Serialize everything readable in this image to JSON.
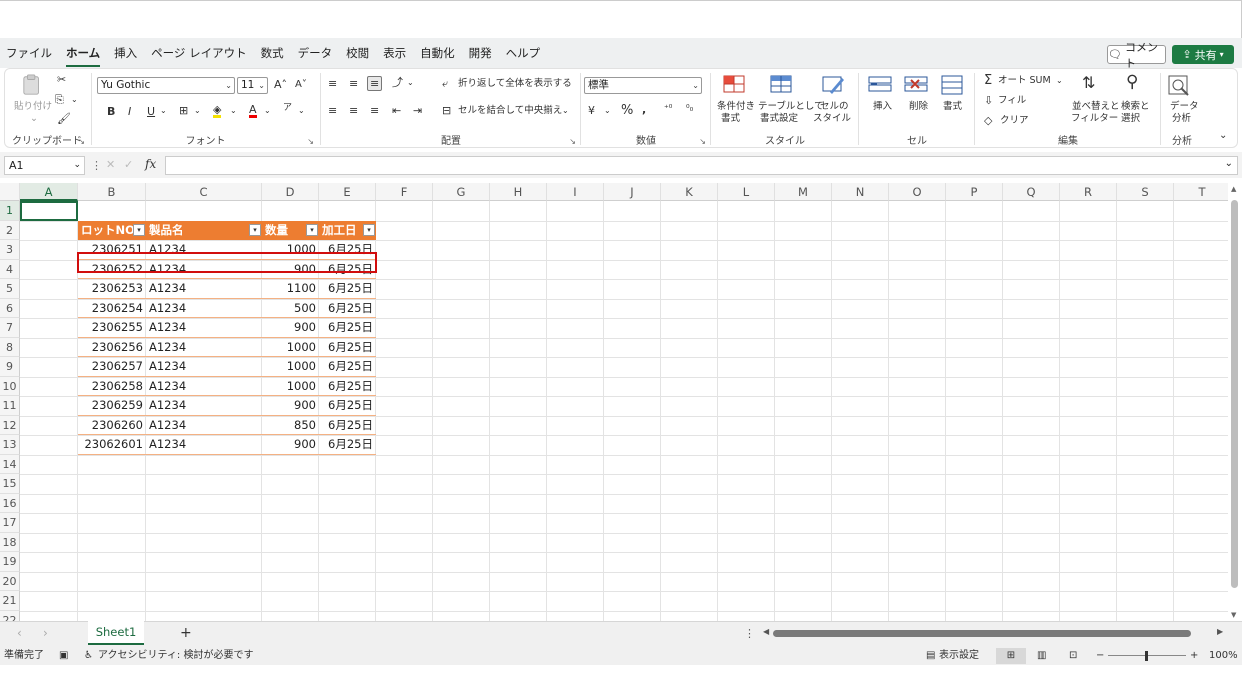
{
  "menu": {
    "tabs": [
      "ファイル",
      "ホーム",
      "挿入",
      "ページ レイアウト",
      "数式",
      "データ",
      "校閲",
      "表示",
      "自動化",
      "開発",
      "ヘルプ"
    ],
    "active_tab": "ホーム",
    "comment_label": "コメント",
    "share_label": "共有"
  },
  "ribbon": {
    "clipboard": {
      "paste": "貼り付け",
      "label": "クリップボード"
    },
    "font": {
      "family": "Yu Gothic",
      "size": "11",
      "label": "フォント"
    },
    "alignment": {
      "wrap": "折り返して全体を表示する",
      "merge": "セルを結合して中央揃え",
      "label": "配置"
    },
    "number": {
      "format": "標準",
      "label": "数値"
    },
    "styles": {
      "cond1": "条件付き",
      "cond2": "書式",
      "table1": "テーブルとして",
      "table2": "書式設定",
      "cell1": "セルの",
      "cell2": "スタイル",
      "label": "スタイル"
    },
    "cells": {
      "insert": "挿入",
      "delete": "削除",
      "format": "書式",
      "label": "セル"
    },
    "editing": {
      "autosum": "オート SUM",
      "fill": "フィル",
      "clear": "クリア",
      "sort1": "並べ替えと",
      "sort2": "フィルター",
      "find1": "検索と",
      "find2": "選択",
      "label": "編集"
    },
    "analysis": {
      "btn1": "データ",
      "btn2": "分析",
      "label": "分析"
    }
  },
  "formula_bar": {
    "namebox": "A1",
    "fx": "fx",
    "content": ""
  },
  "columns": [
    "A",
    "B",
    "C",
    "D",
    "E",
    "F",
    "G",
    "H",
    "I",
    "J",
    "K",
    "L",
    "M",
    "N",
    "O",
    "P",
    "Q",
    "R",
    "S",
    "T"
  ],
  "rows": [
    "1",
    "2",
    "3",
    "4",
    "5",
    "6",
    "7",
    "8",
    "9",
    "10",
    "11",
    "12",
    "13",
    "14",
    "15",
    "16",
    "17",
    "18",
    "19",
    "20",
    "21",
    "22"
  ],
  "table": {
    "headers": [
      "ロットNO",
      "製品名",
      "数量",
      "加工日"
    ],
    "rows": [
      [
        "2306251",
        "A1234",
        "1000",
        "6月25日"
      ],
      [
        "2306252",
        "A1234",
        "900",
        "6月25日"
      ],
      [
        "2306253",
        "A1234",
        "1100",
        "6月25日"
      ],
      [
        "2306254",
        "A1234",
        "500",
        "6月25日"
      ],
      [
        "2306255",
        "A1234",
        "900",
        "6月25日"
      ],
      [
        "2306256",
        "A1234",
        "1000",
        "6月25日"
      ],
      [
        "2306257",
        "A1234",
        "1000",
        "6月25日"
      ],
      [
        "2306258",
        "A1234",
        "1000",
        "6月25日"
      ],
      [
        "2306259",
        "A1234",
        "900",
        "6月25日"
      ],
      [
        "2306260",
        "A1234",
        "850",
        "6月25日"
      ],
      [
        "23062601",
        "A1234",
        "900",
        "6月25日"
      ]
    ]
  },
  "sheets": {
    "active": "Sheet1",
    "add": "+"
  },
  "status": {
    "ready": "準備完了",
    "accessibility": "アクセシビリティ: 検討が必要です",
    "display_settings": "表示設定",
    "zoom": "100%"
  },
  "colors": {
    "accent": "#1d6b40",
    "table_header": "#ed7d31",
    "highlight": "#d10d0d"
  }
}
